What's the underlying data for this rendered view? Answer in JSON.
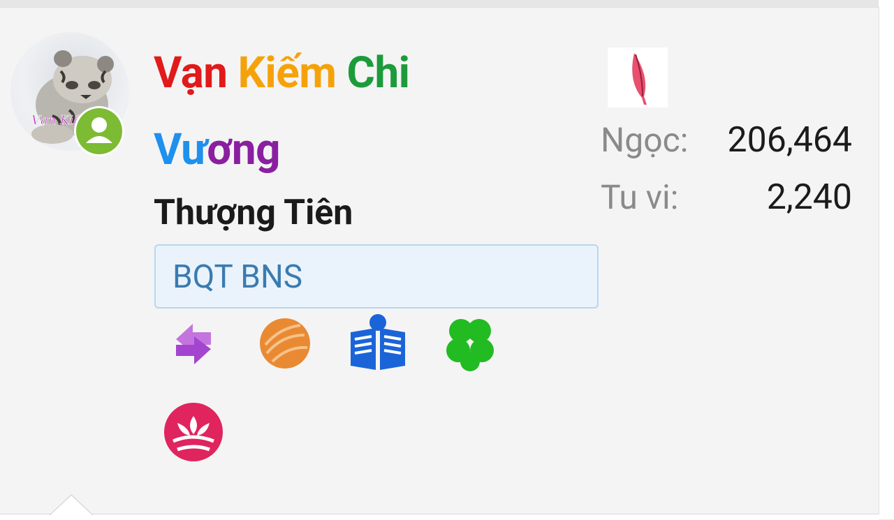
{
  "user": {
    "name_parts": [
      {
        "text": "V",
        "color": "#e11a1a"
      },
      {
        "text": "ạn ",
        "color": "#e11a1a"
      },
      {
        "text": "Kiếm ",
        "color": "#f5a20a"
      },
      {
        "text": "Chi",
        "color": "#1c9b3b"
      },
      {
        "text": "Vư",
        "color": "#1e90ee"
      },
      {
        "text": "ơng",
        "color": "#8a1fa0"
      }
    ],
    "rank": "Thượng Tiên",
    "banner": "BQT BNS",
    "avatar_text": "Vạn Kiếm Chi",
    "status": "online"
  },
  "stats": {
    "ngoc_label": "Ngọc:",
    "ngoc_value": "206,464",
    "tuvi_label": "Tu vi:",
    "tuvi_value": "2,240"
  },
  "trophies": [
    {
      "name": "sync-arrows-icon",
      "color": "#b45cd6"
    },
    {
      "name": "orange-ball-icon",
      "color": "#e98a33"
    },
    {
      "name": "reader-book-icon",
      "color": "#1a64d8"
    },
    {
      "name": "clover-icon",
      "color": "#22bb22"
    },
    {
      "name": "lotus-icon",
      "color": "#e0245e"
    }
  ]
}
